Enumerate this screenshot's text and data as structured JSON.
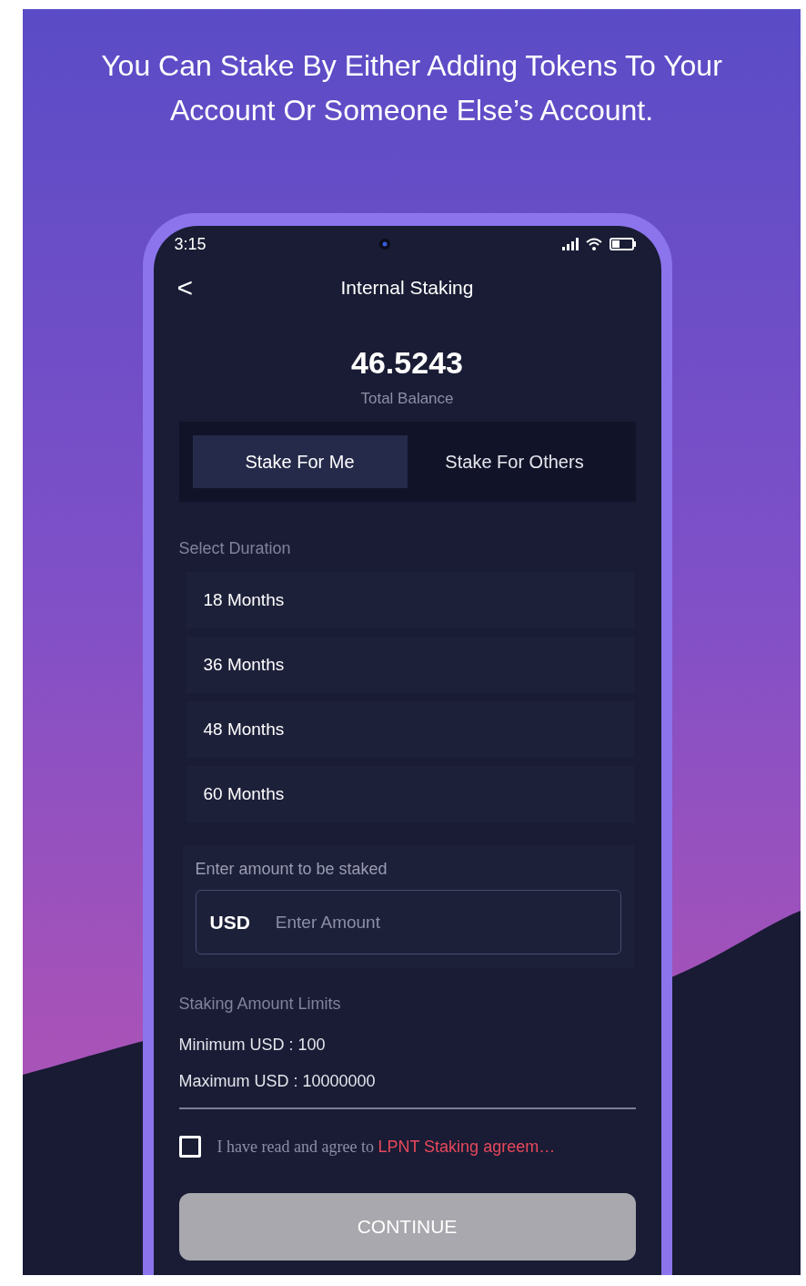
{
  "headline": "You Can Stake By Either Adding Tokens To Your Account Or Someone Else’s Account.",
  "status_bar": {
    "time": "3:15"
  },
  "header": {
    "back": "<",
    "title": "Internal Staking"
  },
  "balance": {
    "amount": "46.5243",
    "label": "Total Balance"
  },
  "tabs": [
    {
      "label": "Stake For Me",
      "selected": true
    },
    {
      "label": "Stake For Others",
      "selected": false
    }
  ],
  "duration": {
    "label": "Select Duration",
    "options": [
      {
        "label": "18 Months",
        "selected": false
      },
      {
        "label": "36 Months",
        "selected": false
      },
      {
        "label": "48 Months",
        "selected": false
      },
      {
        "label": "60 Months",
        "selected": false
      }
    ]
  },
  "amount": {
    "label": "Enter amount to be staked",
    "currency": "USD",
    "placeholder": "Enter Amount"
  },
  "limits": {
    "title": "Staking Amount Limits",
    "lines": [
      "Minimum USD : 100",
      "Maximum USD : 10000000"
    ]
  },
  "agreement": {
    "checked": false,
    "text": "I have read and agree to ",
    "link": "LPNT Staking agreem…"
  },
  "continue": {
    "label": "CONTINUE",
    "disabled": true
  }
}
